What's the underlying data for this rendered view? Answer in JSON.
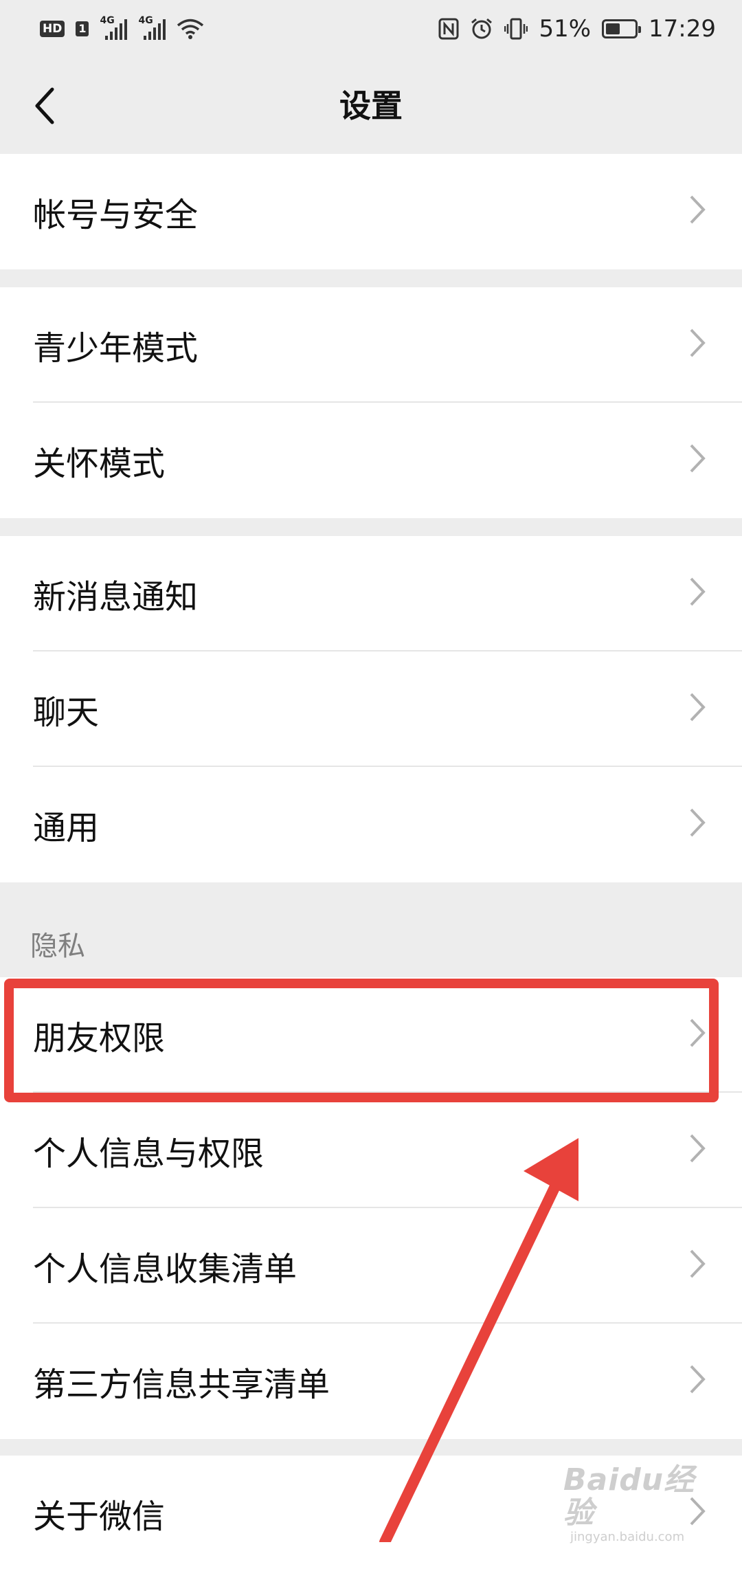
{
  "status_bar": {
    "hd": "HD",
    "sim": "1",
    "sim1_network": "4G",
    "sim2_network": "4G",
    "battery_percent": "51%",
    "battery_level": 0.51,
    "time": "17:29",
    "icons": [
      "signal-icon",
      "wifi-icon",
      "nfc-icon",
      "alarm-icon",
      "vibrate-icon",
      "battery-icon"
    ]
  },
  "header": {
    "title": "设置",
    "back_icon": "back-chevron-icon"
  },
  "groups": {
    "account": {
      "items": [
        {
          "label": "帐号与安全"
        }
      ]
    },
    "modes": {
      "items": [
        {
          "label": "青少年模式"
        },
        {
          "label": "关怀模式"
        }
      ]
    },
    "general": {
      "items": [
        {
          "label": "新消息通知"
        },
        {
          "label": "聊天"
        },
        {
          "label": "通用"
        }
      ]
    },
    "privacy": {
      "header": "隐私",
      "items": [
        {
          "label": "朋友权限"
        },
        {
          "label": "个人信息与权限"
        },
        {
          "label": "个人信息收集清单"
        },
        {
          "label": "第三方信息共享清单"
        }
      ]
    },
    "about": {
      "items": [
        {
          "label": "关于微信"
        }
      ]
    }
  },
  "annotation": {
    "highlight_color": "#e8423b",
    "highlighted_item": "朋友权限"
  },
  "watermark": {
    "brand": "Baidu经验",
    "url": "jingyan.baidu.com"
  }
}
